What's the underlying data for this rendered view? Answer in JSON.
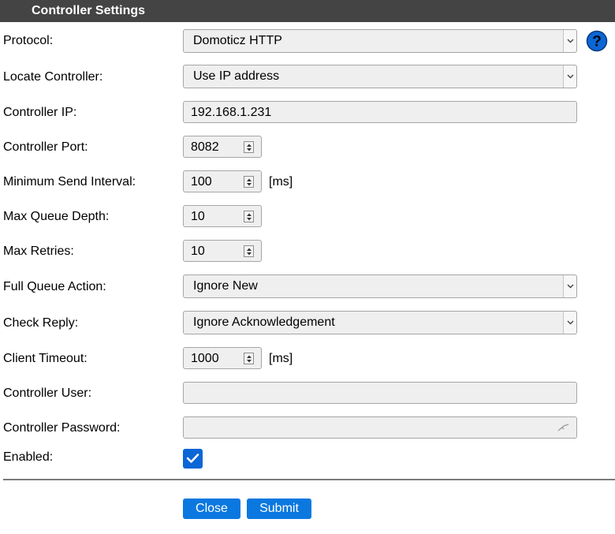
{
  "header": {
    "title": "Controller Settings"
  },
  "fields": {
    "protocol": {
      "label": "Protocol:",
      "value": "Domoticz HTTP"
    },
    "locate": {
      "label": "Locate Controller:",
      "value": "Use IP address"
    },
    "ip": {
      "label": "Controller IP:",
      "value": "192.168.1.231"
    },
    "port": {
      "label": "Controller Port:",
      "value": "8082"
    },
    "min_interval": {
      "label": "Minimum Send Interval:",
      "value": "100",
      "unit": "[ms]"
    },
    "queue_depth": {
      "label": "Max Queue Depth:",
      "value": "10"
    },
    "retries": {
      "label": "Max Retries:",
      "value": "10"
    },
    "full_queue": {
      "label": "Full Queue Action:",
      "value": "Ignore New"
    },
    "check_reply": {
      "label": "Check Reply:",
      "value": "Ignore Acknowledgement"
    },
    "timeout": {
      "label": "Client Timeout:",
      "value": "1000",
      "unit": "[ms]"
    },
    "user": {
      "label": "Controller User:",
      "value": ""
    },
    "password": {
      "label": "Controller Password:",
      "value": ""
    },
    "enabled": {
      "label": "Enabled:",
      "checked": true
    }
  },
  "buttons": {
    "close": "Close",
    "submit": "Submit"
  },
  "colors": {
    "header_bg": "#444444",
    "accent": "#0b78e0",
    "help": "#0b66d6"
  },
  "icons": {
    "help": "question-circle-icon",
    "check": "check-icon",
    "key": "key-icon"
  }
}
